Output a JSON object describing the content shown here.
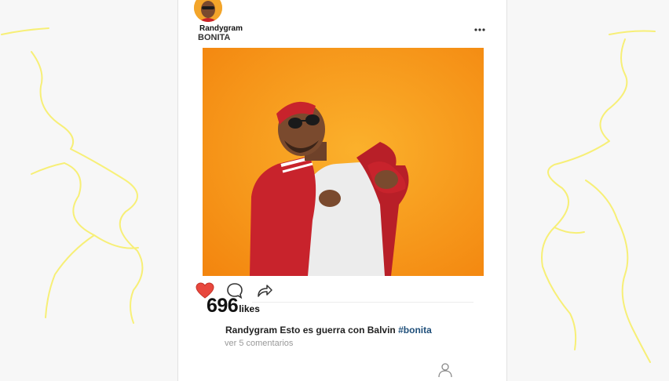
{
  "post": {
    "username": "Randygram",
    "song_title": "BONITA",
    "likes_count": "696",
    "likes_label": "likes",
    "caption_user": "Randygram",
    "caption_text": "Esto es guerra con Balvin",
    "caption_hashtag": "#bonita",
    "view_comments": "ver 5 comentarios"
  },
  "icons": {
    "more": "more-icon",
    "heart": "heart-icon",
    "comment": "comment-icon",
    "share": "share-icon",
    "profile": "profile-icon"
  },
  "colors": {
    "heart": "#e8473d",
    "image_background": "#f79a1a",
    "jacket": "#c8232c",
    "doodle": "#f7ef6a",
    "hashtag": "#1f4f7a"
  }
}
